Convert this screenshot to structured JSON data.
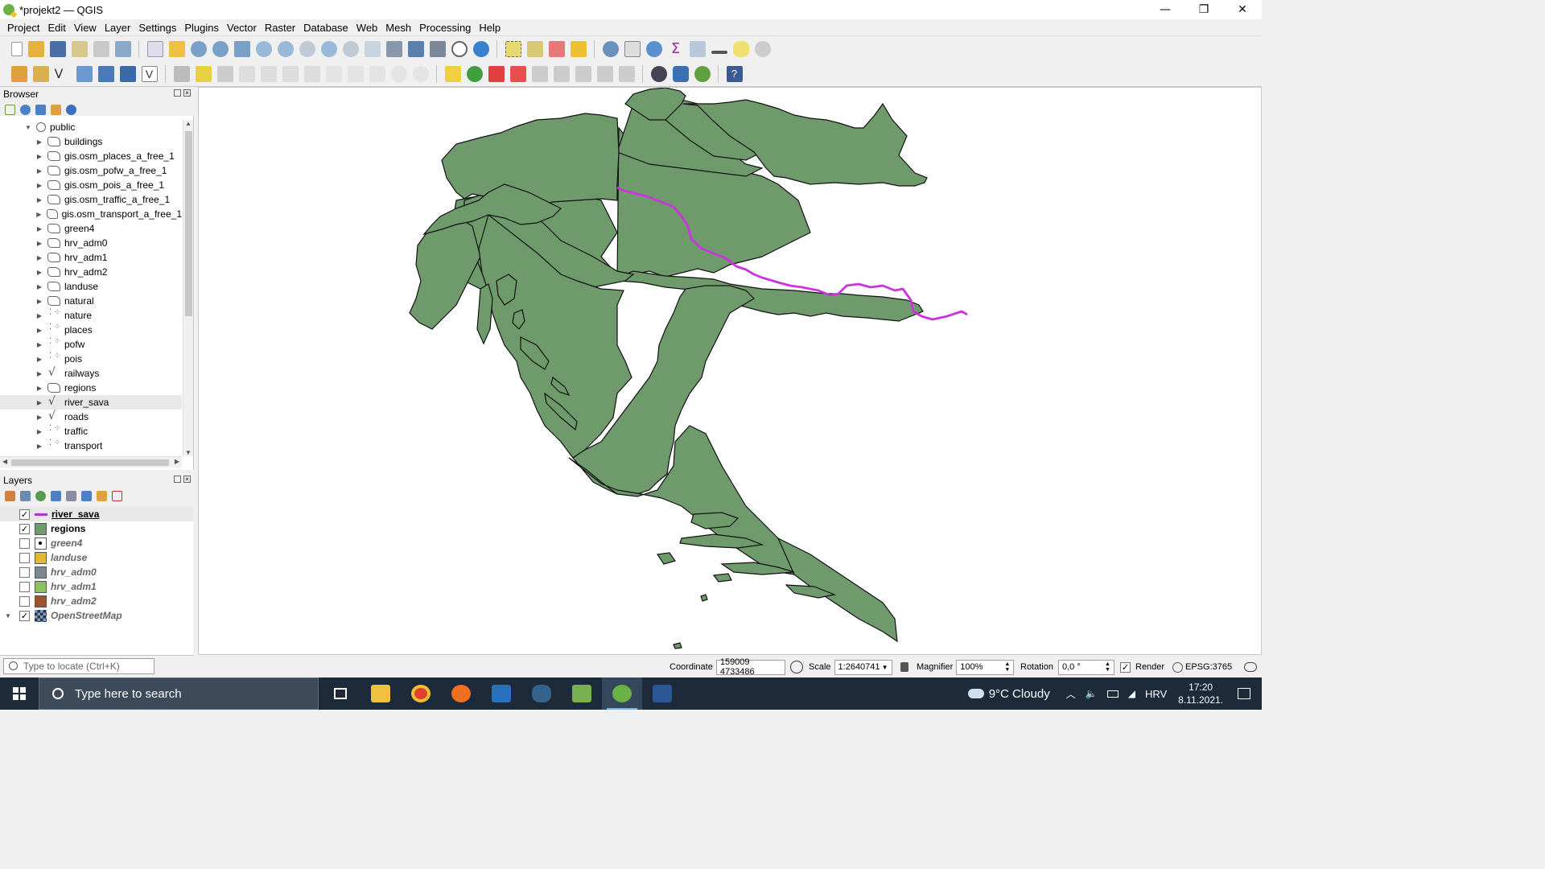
{
  "window": {
    "title": "*projekt2 — QGIS",
    "controls": [
      "—",
      "❐",
      "✕"
    ]
  },
  "menu": [
    "Project",
    "Edit",
    "View",
    "Layer",
    "Settings",
    "Plugins",
    "Vector",
    "Raster",
    "Database",
    "Web",
    "Mesh",
    "Processing",
    "Help"
  ],
  "browser": {
    "title": "Browser",
    "root": "public",
    "items": [
      {
        "label": "buildings",
        "type": "polygon"
      },
      {
        "label": "gis.osm_places_a_free_1",
        "type": "polygon"
      },
      {
        "label": "gis.osm_pofw_a_free_1",
        "type": "polygon"
      },
      {
        "label": "gis.osm_pois_a_free_1",
        "type": "polygon"
      },
      {
        "label": "gis.osm_traffic_a_free_1",
        "type": "polygon"
      },
      {
        "label": "gis.osm_transport_a_free_1",
        "type": "polygon"
      },
      {
        "label": "green4",
        "type": "polygon"
      },
      {
        "label": "hrv_adm0",
        "type": "polygon"
      },
      {
        "label": "hrv_adm1",
        "type": "polygon"
      },
      {
        "label": "hrv_adm2",
        "type": "polygon"
      },
      {
        "label": "landuse",
        "type": "polygon"
      },
      {
        "label": "natural",
        "type": "polygon"
      },
      {
        "label": "nature",
        "type": "point"
      },
      {
        "label": "places",
        "type": "point"
      },
      {
        "label": "pofw",
        "type": "point"
      },
      {
        "label": "pois",
        "type": "point"
      },
      {
        "label": "railways",
        "type": "line"
      },
      {
        "label": "regions",
        "type": "polygon"
      },
      {
        "label": "river_sava",
        "type": "line",
        "selected": true
      },
      {
        "label": "roads",
        "type": "line"
      },
      {
        "label": "traffic",
        "type": "point"
      },
      {
        "label": "transport",
        "type": "point"
      }
    ]
  },
  "layers": {
    "title": "Layers",
    "items": [
      {
        "label": "river_sava",
        "checked": true,
        "symbol": "line",
        "color": "#b030d8",
        "active": true,
        "selected": true
      },
      {
        "label": "regions",
        "checked": true,
        "symbol": "fill",
        "color": "#6e9a6c",
        "active": true
      },
      {
        "label": "green4",
        "checked": false,
        "symbol": "point",
        "color": "#ffffff"
      },
      {
        "label": "landuse",
        "checked": false,
        "symbol": "fill",
        "color": "#e0b83a"
      },
      {
        "label": "hrv_adm0",
        "checked": false,
        "symbol": "fill",
        "color": "#7a8890"
      },
      {
        "label": "hrv_adm1",
        "checked": false,
        "symbol": "fill",
        "color": "#8cc060"
      },
      {
        "label": "hrv_adm2",
        "checked": false,
        "symbol": "fill",
        "color": "#a0522d"
      },
      {
        "label": "OpenStreetMap",
        "checked": true,
        "symbol": "raster",
        "color": "#333333",
        "group": true
      }
    ]
  },
  "map": {
    "fill_color": "#6e9a6c",
    "river_color": "#cc33dd"
  },
  "status": {
    "locator_placeholder": "Type to locate (Ctrl+K)",
    "coordinate_label": "Coordinate",
    "coordinate": "159009 4733486",
    "scale_label": "Scale",
    "scale": "1:2640741",
    "magnifier_label": "Magnifier",
    "magnifier": "100%",
    "rotation_label": "Rotation",
    "rotation": "0,0 °",
    "render_label": "Render",
    "crs": "EPSG:3765"
  },
  "taskbar": {
    "search_placeholder": "Type here to search",
    "weather": "9°C  Cloudy",
    "language": "HRV",
    "time": "17:20",
    "date": "8.11.2021."
  }
}
